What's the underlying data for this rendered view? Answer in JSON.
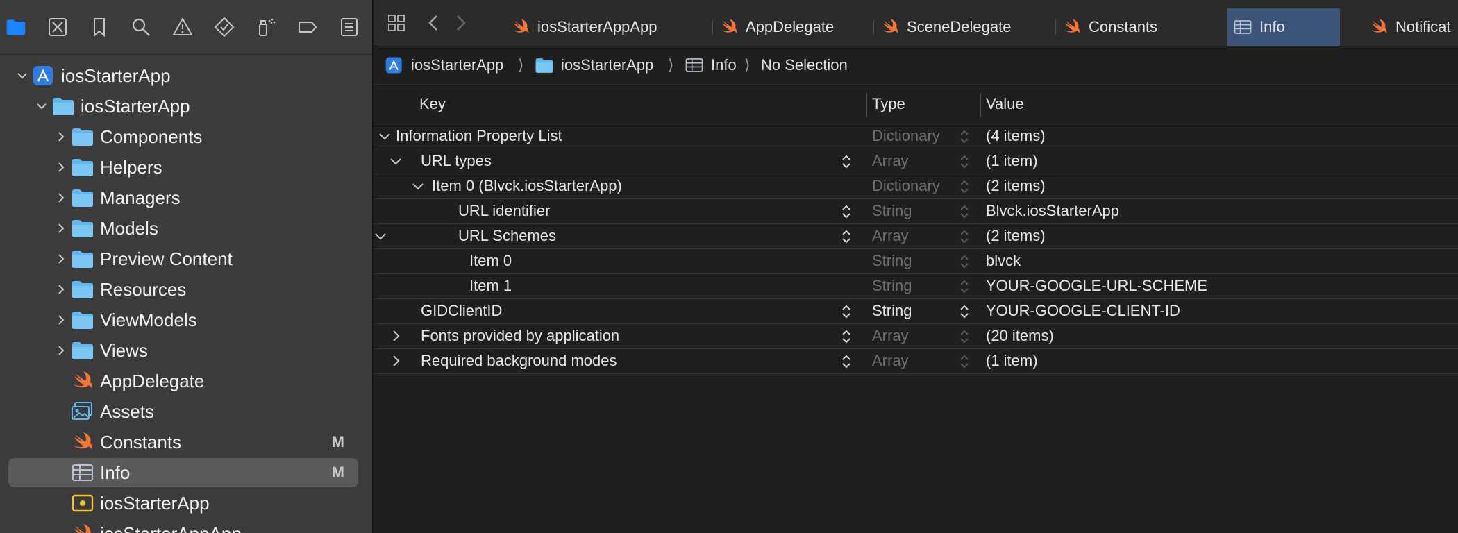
{
  "navigator": {
    "toolbar_icons": [
      "folder-icon",
      "source-control-icon",
      "bookmark-icon",
      "search-icon",
      "warning-icon",
      "test-diamond-icon",
      "debug-spray-icon",
      "breakpoint-icon",
      "report-icon"
    ],
    "tree": [
      {
        "label": "iosStarterApp",
        "icon": "project-icon",
        "depth": 0,
        "expanded": true,
        "badge": ""
      },
      {
        "label": "iosStarterApp",
        "icon": "folder-icon",
        "depth": 1,
        "expanded": true,
        "badge": ""
      },
      {
        "label": "Components",
        "icon": "folder-icon",
        "depth": 2,
        "expanded": false,
        "badge": ""
      },
      {
        "label": "Helpers",
        "icon": "folder-icon",
        "depth": 2,
        "expanded": false,
        "badge": ""
      },
      {
        "label": "Managers",
        "icon": "folder-icon",
        "depth": 2,
        "expanded": false,
        "badge": ""
      },
      {
        "label": "Models",
        "icon": "folder-icon",
        "depth": 2,
        "expanded": false,
        "badge": ""
      },
      {
        "label": "Preview Content",
        "icon": "folder-icon",
        "depth": 2,
        "expanded": false,
        "badge": ""
      },
      {
        "label": "Resources",
        "icon": "folder-icon",
        "depth": 2,
        "expanded": false,
        "badge": ""
      },
      {
        "label": "ViewModels",
        "icon": "folder-icon",
        "depth": 2,
        "expanded": false,
        "badge": ""
      },
      {
        "label": "Views",
        "icon": "folder-icon",
        "depth": 2,
        "expanded": false,
        "badge": ""
      },
      {
        "label": "AppDelegate",
        "icon": "swift-icon",
        "depth": 2,
        "expanded": null,
        "badge": ""
      },
      {
        "label": "Assets",
        "icon": "assets-icon",
        "depth": 2,
        "expanded": null,
        "badge": ""
      },
      {
        "label": "Constants",
        "icon": "swift-icon",
        "depth": 2,
        "expanded": null,
        "badge": "M"
      },
      {
        "label": "Info",
        "icon": "plist-icon",
        "depth": 2,
        "expanded": null,
        "badge": "M",
        "selected": true
      },
      {
        "label": "iosStarterApp",
        "icon": "entitlements-icon",
        "depth": 2,
        "expanded": null,
        "badge": ""
      },
      {
        "label": "iosStarterAppApp",
        "icon": "swift-icon",
        "depth": 2,
        "expanded": null,
        "badge": ""
      }
    ]
  },
  "tabs": [
    {
      "label": "iosStarterAppApp",
      "icon": "swift-icon",
      "active": false
    },
    {
      "label": "AppDelegate",
      "icon": "swift-icon",
      "active": false
    },
    {
      "label": "SceneDelegate",
      "icon": "swift-icon",
      "active": false
    },
    {
      "label": "Constants",
      "icon": "swift-icon",
      "active": false
    },
    {
      "label": "Info",
      "icon": "plist-icon",
      "active": true
    },
    {
      "label": "Notificat",
      "icon": "swift-icon",
      "active": false
    }
  ],
  "jumpbar": {
    "items": [
      {
        "label": "iosStarterApp",
        "icon": "project-icon"
      },
      {
        "label": "iosStarterApp",
        "icon": "folder-icon"
      },
      {
        "label": "Info",
        "icon": "plist-icon"
      },
      {
        "label": "No Selection",
        "icon": ""
      }
    ],
    "separator": "⟩"
  },
  "plist": {
    "headers": {
      "key": "Key",
      "type": "Type",
      "value": "Value"
    },
    "rows": [
      {
        "key": "Information Property List",
        "type": "Dictionary",
        "value": "(4 items)",
        "depth": 0,
        "disclosure": "open",
        "type_editable": false,
        "key_stepper": false
      },
      {
        "key": "URL types",
        "type": "Array",
        "value": "(1 item)",
        "depth": 1,
        "disclosure": "open",
        "type_editable": false,
        "key_stepper": true
      },
      {
        "key": "Item 0 (Blvck.iosStarterApp)",
        "type": "Dictionary",
        "value": "(2 items)",
        "depth": 2,
        "disclosure": "open",
        "type_editable": false,
        "key_stepper": false
      },
      {
        "key": "URL identifier",
        "type": "String",
        "value": "Blvck.iosStarterApp",
        "depth": 3,
        "disclosure": "none",
        "type_editable": false,
        "key_stepper": true
      },
      {
        "key": "URL Schemes",
        "type": "Array",
        "value": "(2 items)",
        "depth": 3,
        "disclosure": "open",
        "type_editable": false,
        "key_stepper": true
      },
      {
        "key": "Item 0",
        "type": "String",
        "value": "blvck",
        "depth": 4,
        "disclosure": "none",
        "type_editable": false,
        "key_stepper": false
      },
      {
        "key": "Item 1",
        "type": "String",
        "value": "YOUR-GOOGLE-URL-SCHEME",
        "depth": 4,
        "disclosure": "none",
        "type_editable": false,
        "key_stepper": false
      },
      {
        "key": "GIDClientID",
        "type": "String",
        "value": "YOUR-GOOGLE-CLIENT-ID",
        "depth": 1,
        "disclosure": "none",
        "type_editable": true,
        "key_stepper": true
      },
      {
        "key": "Fonts provided by application",
        "type": "Array",
        "value": "(20 items)",
        "depth": 1,
        "disclosure": "closed",
        "type_editable": false,
        "key_stepper": true
      },
      {
        "key": "Required background modes",
        "type": "Array",
        "value": "(1 item)",
        "depth": 1,
        "disclosure": "closed",
        "type_editable": false,
        "key_stepper": true
      }
    ]
  },
  "colors": {
    "accent": "#1b84ff",
    "swift": "#f2753a",
    "folder": "#62b7ef",
    "selected_tab": "#3d5479"
  }
}
